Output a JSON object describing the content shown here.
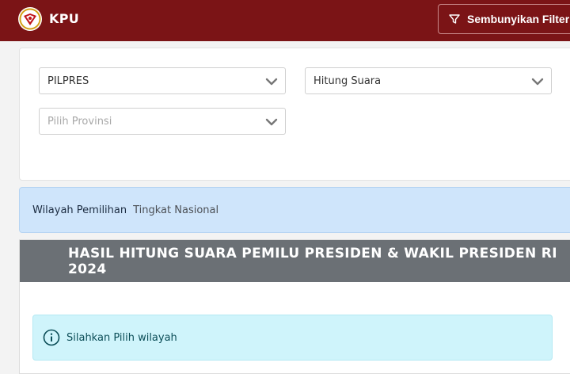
{
  "header": {
    "brand": "KPU",
    "filter_button_label": "Sembunyikan Filter"
  },
  "filters": {
    "election": {
      "value": "PILPRES"
    },
    "count_type": {
      "value": "Hitung Suara"
    },
    "province": {
      "placeholder": "Pilih Provinsi"
    }
  },
  "region": {
    "label": "Wilayah Pemilihan",
    "value": "Tingkat Nasional"
  },
  "result": {
    "title": "HASIL HITUNG SUARA PEMILU PRESIDEN & WAKIL PRESIDEN RI 2024",
    "alert": "Silahkan Pilih wilayah"
  },
  "colors": {
    "header_bg": "#7b1416",
    "region_bg": "#cfe5fb",
    "result_header_bg": "#6b7075",
    "alert_bg": "#cff4fb"
  }
}
